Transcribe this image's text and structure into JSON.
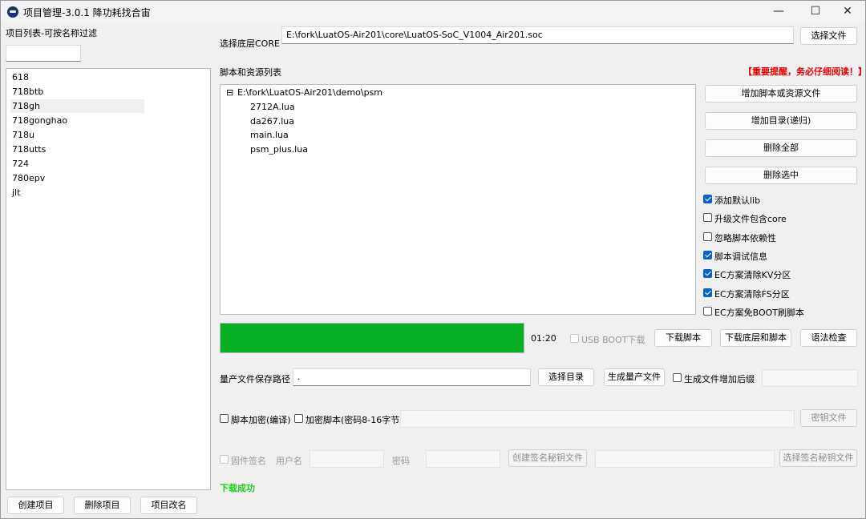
{
  "window": {
    "title": "项目管理-3.0.1 降功耗找合宙",
    "minimize": "—",
    "maximize": "☐",
    "close": "✕"
  },
  "left": {
    "project_list_label": "项目列表-可按名称过滤",
    "filter_value": "",
    "projects": [
      "618",
      "718btb",
      "718gh",
      "718gonghao",
      "718u",
      "718utts",
      "724",
      "780epv",
      "jlt"
    ],
    "selected_project": "718gh",
    "create_button": "创建项目",
    "delete_button": "删除项目",
    "rename_button": "项目改名"
  },
  "core": {
    "label": "选择底层CORE",
    "path": "E:\\fork\\LuatOS-Air201\\core\\LuatOS-SoC_V1004_Air201.soc",
    "select_button": "选择文件"
  },
  "scripts": {
    "label": "脚本和资源列表",
    "warning": "【重要提醒，务必仔细阅读！】",
    "tree_root_toggle": "⊟",
    "tree_root": "E:\\fork\\LuatOS-Air201\\demo\\psm",
    "files": [
      "2712A.lua",
      "da267.lua",
      "main.lua",
      "psm_plus.lua"
    ]
  },
  "actions": {
    "add_script": "增加脚本或资源文件",
    "add_dir": "增加目录(递归)",
    "delete_all": "删除全部",
    "delete_selected": "删除选中"
  },
  "options": [
    {
      "label": "添加默认lib",
      "checked": true
    },
    {
      "label": "升级文件包含core",
      "checked": false
    },
    {
      "label": "忽略脚本依赖性",
      "checked": false
    },
    {
      "label": "脚本调试信息",
      "checked": true
    },
    {
      "label": "EC方案清除KV分区",
      "checked": true
    },
    {
      "label": "EC方案清除FS分区",
      "checked": true
    },
    {
      "label": "EC方案免BOOT刷脚本",
      "checked": false
    }
  ],
  "download": {
    "progress_percent": 100,
    "progress_color": "#06b025",
    "time": "01:20",
    "usb_boot_label": "USB BOOT下载",
    "download_script": "下载脚本",
    "download_core_script": "下载底层和脚本",
    "syntax_check": "语法检查"
  },
  "mass": {
    "label": "量产文件保存路径",
    "path": ".",
    "select_dir": "选择目录",
    "generate": "生成量产文件",
    "suffix_label": "生成文件增加后缀",
    "suffix_value": ""
  },
  "encrypt": {
    "compile_label": "脚本加密(编译)",
    "encrypt_label": "加密脚本(密码8-16字节)",
    "password_value": "",
    "key_file_button": "密钥文件"
  },
  "sign": {
    "firmware_sign_label": "固件签名",
    "username_label": "用户名",
    "username_value": "",
    "password_label": "密码",
    "password_value": "",
    "create_key_button": "创建签名秘钥文件",
    "key_path_value": "",
    "select_key_button": "选择签名秘钥文件"
  },
  "status": {
    "text": "下载成功",
    "color": "#1ed01e"
  }
}
